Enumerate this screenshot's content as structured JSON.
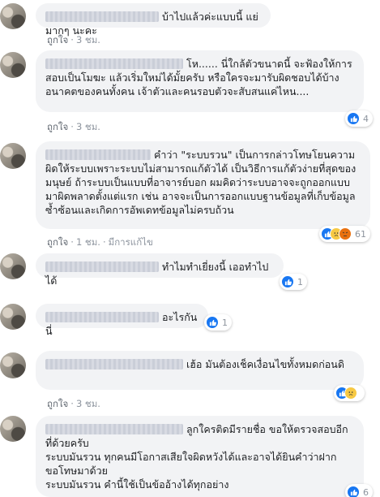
{
  "meta": {
    "like_label": "ถูกใจ",
    "edited_label": "มีการแก้ไข"
  },
  "comments": [
    {
      "text": "บ้าไปแล้วค่ะแบบนี้ แย่มากๆ นะคะ",
      "time": "3 ชม.",
      "reactions": null
    },
    {
      "text": "โห...... นี่ใกล้ตัวขนาดนี้ จะฟ้องให้การสอบเป็นโมฆะ แล้วเริ่มใหม่ได้มั้ยครับ หรือใครจะมารับผิดชอบได้บ้าง อนาคตของคนทั้งคน เจ้าตัวและคนรอบตัวจะสับสนแค่ไหน....",
      "time": "3 ชม.",
      "reactions": "4"
    },
    {
      "text": "คำว่า \"ระบบรวน\" เป็นการกล่าวโทษโยนความผิดให้ระบบเพราะระบบไม่สามารถแก้ตัวได้ เป็นวิธีการแก้ตัวง่ายที่สุดของมนุษย์ ถ้าระบบเป็นแบบที่อาจารย์บอก ผมคิดว่าระบบอาจจะถูกออกแบบมาผิดพลาดตั้งแต่แรก เช่น อาจจะเป็นการออกแบบฐานข้อมูลที่เก็บข้อมูลซ้ำซ้อนและเกิดการอัพเดทข้อมูลไม่ครบถ้วน",
      "time": "1 ชม.",
      "reactions": "61"
    },
    {
      "text": "ทำไมทำเยี่ยงนี้ เออทำไปได้",
      "time": "",
      "reactions": "1"
    },
    {
      "text": "อะไรกันนี่",
      "time": "",
      "reactions": "1"
    },
    {
      "text": "เฮ้อ มันต้องเช็คเงื่อนไขทั้งหมดก่อนดิ",
      "time": "3 ชม.",
      "reactions": ""
    },
    {
      "text": "ลูกใครติดมีรายชื่อ ขอให้ตรวจสอบอีกที่ด้วยครับ",
      "text2": "ระบบมันรวน ทุกคนมีโอกาสเสียใจผิดหวังได้และอาจได้ยินคำว่าฝากขอโทษมาด้วย",
      "text3": "ระบบมันรวน คำนี้ใช้เป็นข้ออ้างได้ทุกอย่าง",
      "time": "",
      "reactions": "6"
    }
  ]
}
